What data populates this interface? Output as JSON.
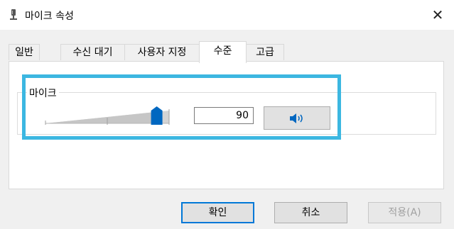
{
  "window": {
    "title": "마이크 속성",
    "close_glyph": "✕"
  },
  "icons": {
    "title": "microphone-icon",
    "speaker": "speaker-icon",
    "close": "close-icon"
  },
  "tabs": [
    {
      "label": "일반",
      "active": false
    },
    {
      "label": "수신 대기",
      "active": false
    },
    {
      "label": "사용자 지정",
      "active": false
    },
    {
      "label": "수준",
      "active": true
    },
    {
      "label": "고급",
      "active": false
    }
  ],
  "levels": {
    "group_label": "마이크",
    "value": "90",
    "slider_fraction": 0.9
  },
  "buttons": {
    "ok": "확인",
    "cancel": "취소",
    "apply": "적용(A)"
  },
  "colors": {
    "accent": "#0078d7",
    "highlight": "#3cb7e1",
    "thumb": "#0067c0"
  }
}
